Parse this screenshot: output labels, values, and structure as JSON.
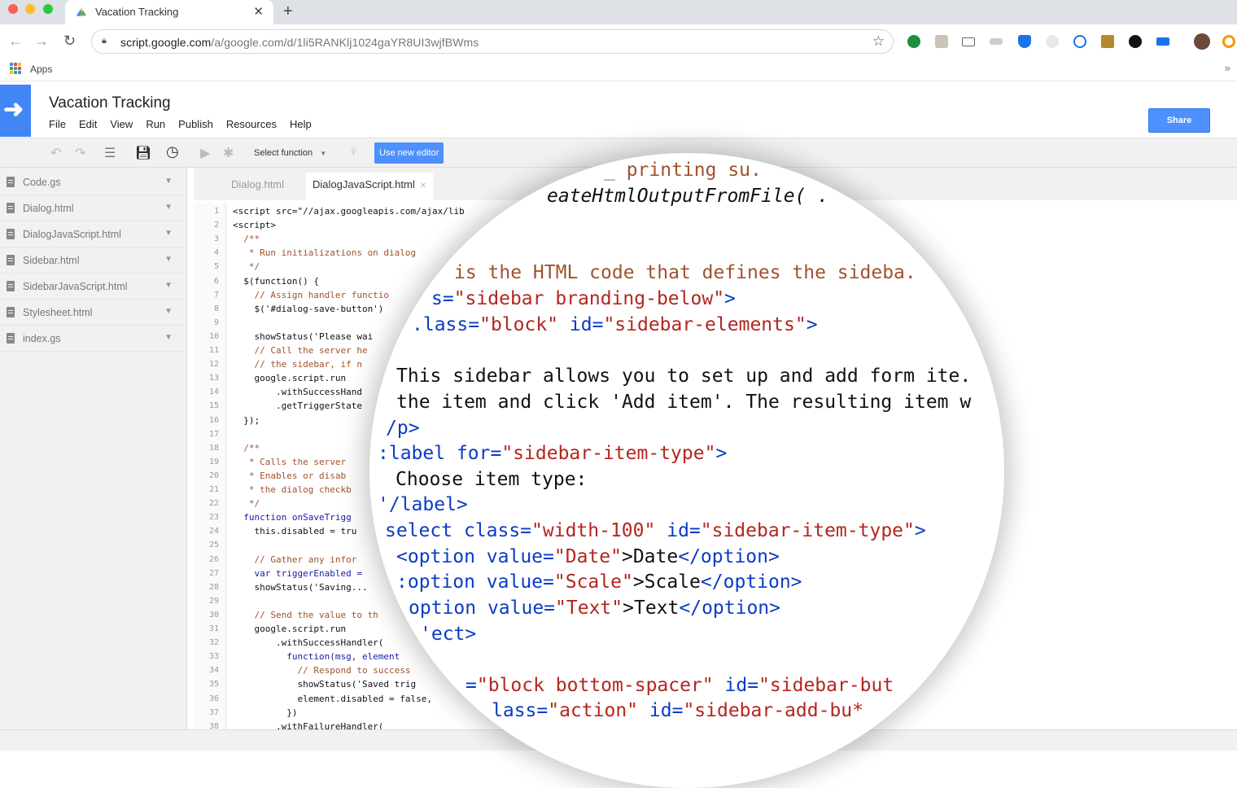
{
  "browser": {
    "tab_title": "Vacation Tracking",
    "url_host": "script.google.com",
    "url_path": "/a/google.com/d/1li5RANKlj1024gaYR8UI3wjfBWms",
    "bookmarks_apps": "Apps"
  },
  "gas": {
    "project_title": "Vacation Tracking",
    "menu": [
      "File",
      "Edit",
      "View",
      "Run",
      "Publish",
      "Resources",
      "Help"
    ],
    "share_label": "Share",
    "toolbar": {
      "select_function": "Select function",
      "new_editor": "Use new editor"
    }
  },
  "files": [
    "Code.gs",
    "Dialog.html",
    "DialogJavaScript.html",
    "Sidebar.html",
    "SidebarJavaScript.html",
    "Stylesheet.html",
    "index.gs"
  ],
  "editor_tabs": [
    {
      "label": "Dialog.html",
      "active": false
    },
    {
      "label": "DialogJavaScript.html",
      "active": true
    }
  ],
  "code_lines": [
    "<script src=\"//ajax.googleapis.com/ajax/lib",
    "<script>",
    "  /**",
    "   * Run initializations on dialog ",
    "   */",
    "  $(function() {",
    "    // Assign handler functio",
    "    $('#dialog-save-button')",
    "",
    "    showStatus('Please wai",
    "    // Call the server he",
    "    // the sidebar, if n",
    "    google.script.run",
    "        .withSuccessHand",
    "        .getTriggerState",
    "  });",
    "",
    "  /**",
    "   * Calls the server",
    "   * Enables or disab",
    "   * the dialog checkb",
    "   */",
    "  function onSaveTrigg",
    "    this.disabled = tru",
    "",
    "    // Gather any infor",
    "    var triggerEnabled =",
    "    showStatus('Saving...",
    "",
    "    // Send the value to th",
    "    google.script.run",
    "        .withSuccessHandler(",
    "          function(msg, element",
    "            // Respond to success",
    "            showStatus('Saved trig",
    "            element.disabled = false,",
    "          })",
    "        .withFailureHandler("
  ],
  "magnified": {
    "l1": "_ printing su.",
    "l2": "eateHtmlOutputFromFile( .",
    "l3": "is the HTML code that defines the sideba.",
    "l4_attr": "s=",
    "l4_val": "\"sidebar branding-below\"",
    "l4_end": ">",
    "l5_attr": ".lass=",
    "l5_val": "\"block\"",
    "l5_attr2": "id=",
    "l5_val2": "\"sidebar-elements\"",
    "l5_end": ">",
    "l6": "This sidebar allows you to set up and add form ite.",
    "l7": "the item and click 'Add item'. The resulting item w",
    "l8": "/p>",
    "l9_tag": ":label ",
    "l9_attr": "for=",
    "l9_val": "\"sidebar-item-type\"",
    "l9_end": ">",
    "l10": "Choose item type:",
    "l11": "'/label>",
    "l12_tag": "select ",
    "l12_attr": "class=",
    "l12_val": "\"width-100\"",
    "l12_attr2": "id=",
    "l12_val2": "\"sidebar-item-type\"",
    "l12_end": ">",
    "opt1_tag": "<option ",
    "opt1_attr": "value=",
    "opt1_val": "\"Date\"",
    "opt1_text": ">Date",
    "opt1_close": "</option>",
    "opt2_tag": ":option ",
    "opt2_attr": "value=",
    "opt2_val": "\"Scale\"",
    "opt2_text": ">Scale",
    "opt2_close": "</option>",
    "opt3_tag": "option ",
    "opt3_attr": "value=",
    "opt3_val": "\"Text\"",
    "opt3_text": ">Text",
    "opt3_close": "</option>",
    "l16": "'ect>",
    "l17_attr": "=",
    "l17_val": "\"block bottom-spacer\"",
    "l17_attr2": "id=",
    "l17_val2": "\"sidebar-but",
    "l18_attr": "lass=",
    "l18_val": "\"action\"",
    "l18_attr2": "id=",
    "l18_val2": "\"sidebar-add-bu*"
  },
  "colors": {
    "accent": "#4285f4",
    "share": "#4d90fe"
  }
}
